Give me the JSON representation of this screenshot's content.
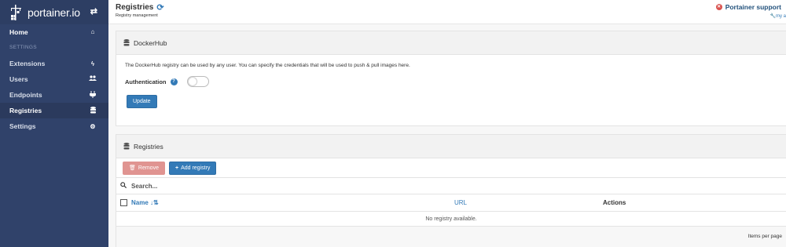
{
  "sidebar": {
    "brand": "portainer.io",
    "items": [
      {
        "label": "Home",
        "icon": "home-icon",
        "glyph": "⌂"
      },
      {
        "section": "SETTINGS"
      },
      {
        "label": "Extensions",
        "icon": "bolt-icon",
        "glyph": "ϟ"
      },
      {
        "label": "Users",
        "icon": "users-icon",
        "glyph": "👥"
      },
      {
        "label": "Endpoints",
        "icon": "plug-icon",
        "glyph": "⏚"
      },
      {
        "label": "Registries",
        "icon": "database-icon",
        "glyph": "≡"
      },
      {
        "label": "Settings",
        "icon": "cogs-icon",
        "glyph": "⚙"
      }
    ]
  },
  "header": {
    "title": "Registries",
    "breadcrumb": "Registry management",
    "support_label": "Portainer support",
    "account_link": "my a"
  },
  "dockerhub": {
    "title": "DockerHub",
    "description": "The DockerHub registry can be used by any user. You can specify the credentials that will be used to push & pull images here.",
    "auth_label": "Authentication",
    "auth_enabled": false,
    "update_label": "Update"
  },
  "registries": {
    "title": "Registries",
    "remove_label": "Remove",
    "add_label": "Add registry",
    "search_placeholder": "Search...",
    "columns": {
      "name": "Name",
      "url": "URL",
      "actions": "Actions"
    },
    "empty_text": "No registry available.",
    "items_per_page_label": "Items per page"
  },
  "colors": {
    "sidebar_bg": "#30426a",
    "primary": "#337ab7",
    "danger": "#d9534f"
  }
}
